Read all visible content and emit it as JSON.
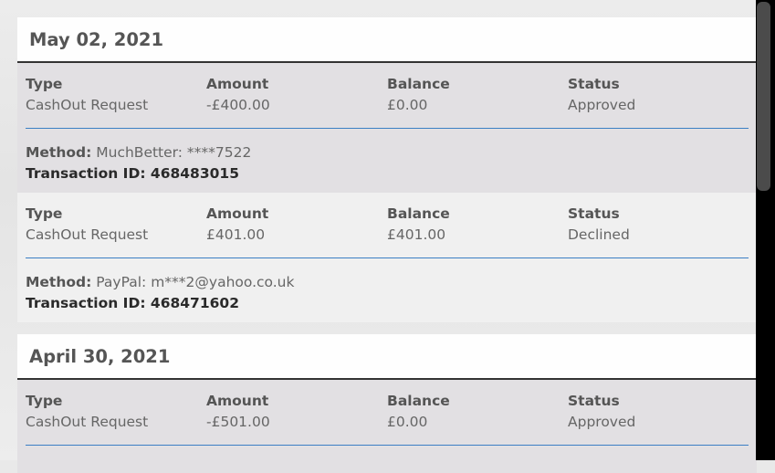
{
  "columns": {
    "type": "Type",
    "amount": "Amount",
    "balance": "Balance",
    "status": "Status"
  },
  "meta_labels": {
    "method": "Method:",
    "transaction_id": "Transaction ID:"
  },
  "groups": [
    {
      "date": "May 02, 2021",
      "transactions": [
        {
          "type": "CashOut Request",
          "amount": "-£400.00",
          "balance": "£0.00",
          "status": "Approved",
          "method": "MuchBetter: ****7522",
          "transaction_id": "468483015"
        },
        {
          "type": "CashOut Request",
          "amount": "£401.00",
          "balance": "£401.00",
          "status": "Declined",
          "method": "PayPal: m***2@yahoo.co.uk",
          "transaction_id": "468471602"
        }
      ]
    },
    {
      "date": "April 30, 2021",
      "transactions": [
        {
          "type": "CashOut Request",
          "amount": "-£501.00",
          "balance": "£0.00",
          "status": "Approved"
        }
      ]
    }
  ],
  "colors": {
    "divider": "#3b7fc4",
    "header_border": "#333333",
    "scrollbar_thumb": "#4b4b4b"
  }
}
